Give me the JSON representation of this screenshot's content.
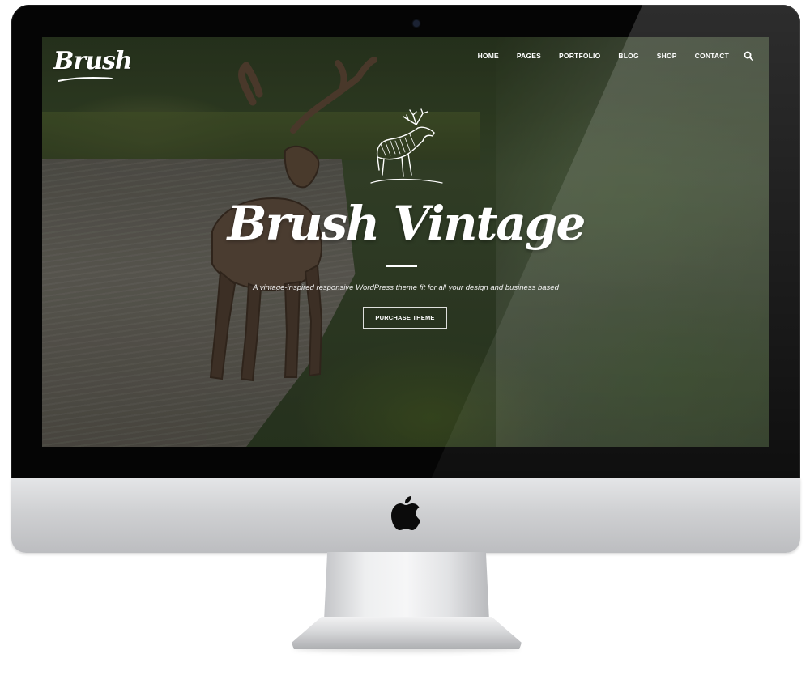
{
  "site": {
    "logo_text": "Brush",
    "nav_items": [
      "HOME",
      "PAGES",
      "PORTFOLIO",
      "BLOG",
      "SHOP",
      "CONTACT"
    ],
    "search_icon": "search-icon"
  },
  "hero": {
    "title": "Brush Vintage",
    "tagline": "A vintage-inspired responsive WordPress theme fit for all your design and business based",
    "cta_label": "PURCHASE THEME",
    "emblem_icon": "elk-emblem-icon"
  },
  "device": {
    "brand_icon": "apple-logo-icon"
  },
  "colors": {
    "text": "#ffffff",
    "bezel": "#050505",
    "aluminum": "#d0d1d3"
  }
}
